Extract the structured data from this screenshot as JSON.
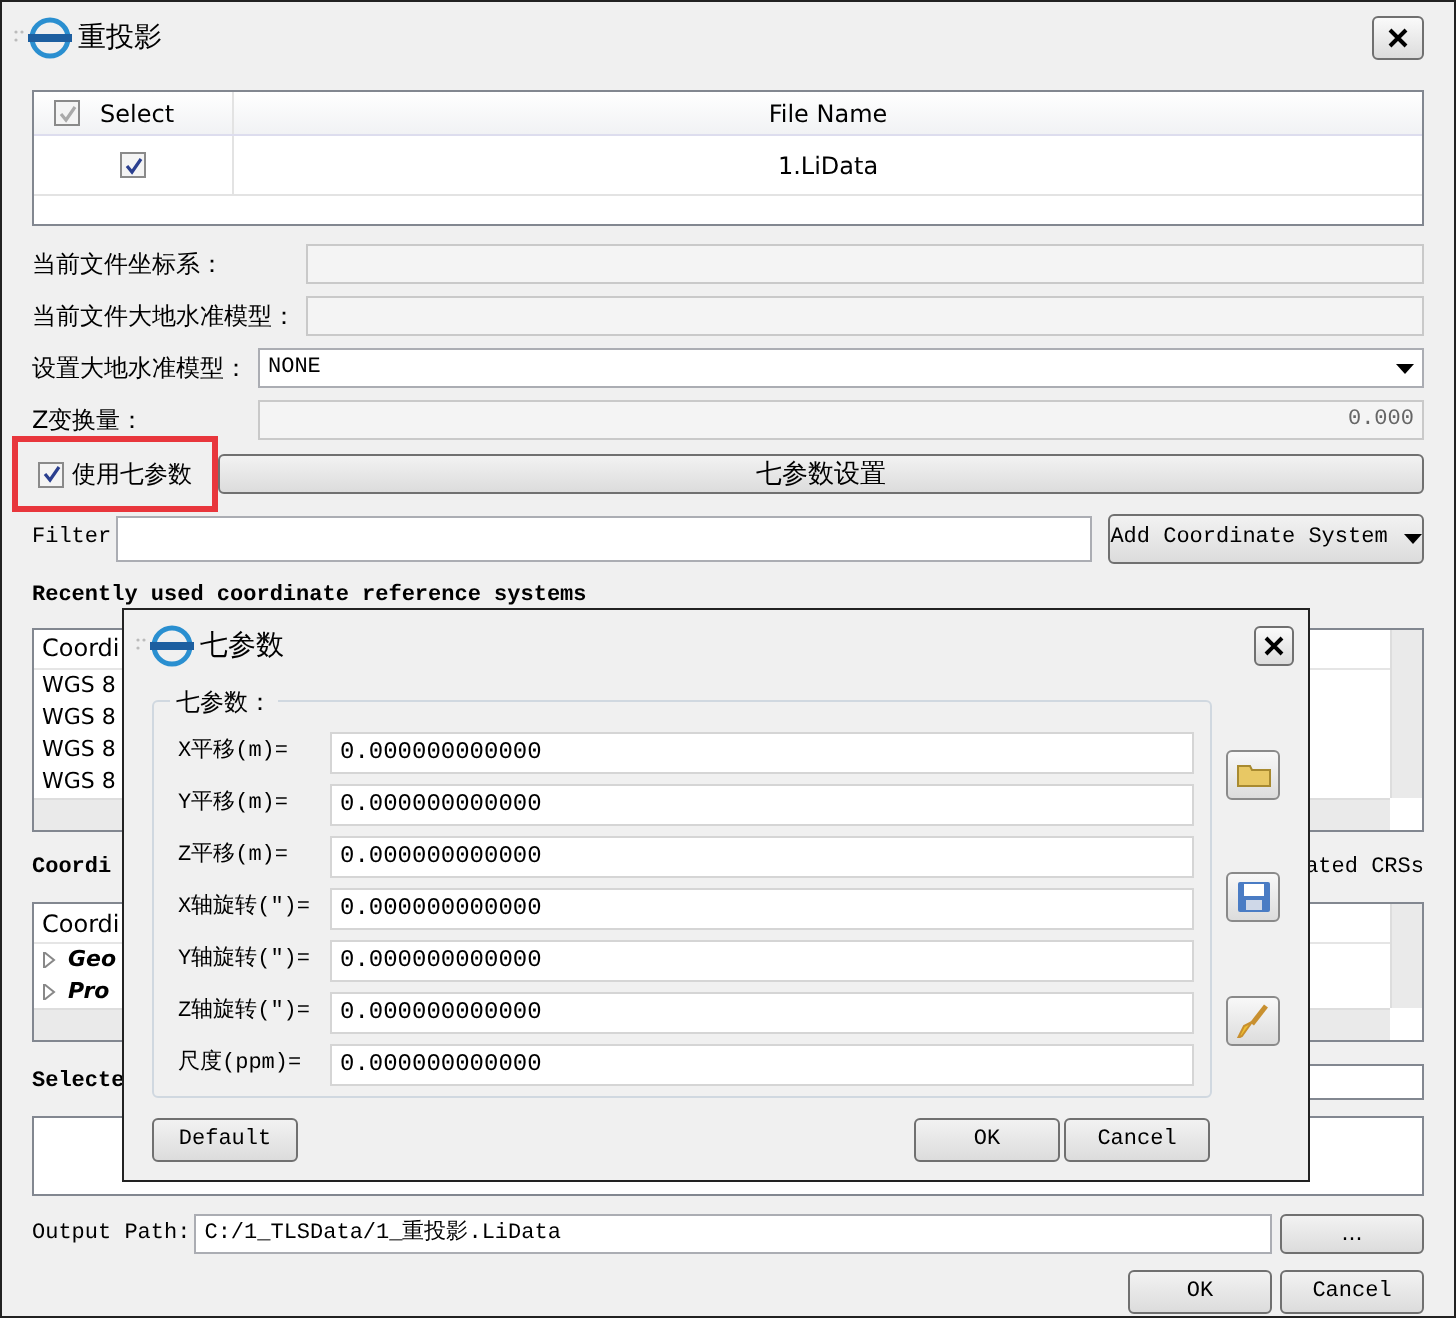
{
  "window": {
    "title": "重投影"
  },
  "file_table": {
    "columns": [
      "Select",
      "File Name"
    ],
    "header_checked": true,
    "rows": [
      {
        "checked": true,
        "file_name": "1.LiData"
      }
    ]
  },
  "fields": [
    {
      "label": "当前文件坐标系：",
      "kind": "text",
      "disabled": true
    },
    {
      "label": "当前文件大地水准模型：",
      "kind": "text",
      "disabled": true
    },
    {
      "label": "设置大地水准模型：",
      "kind": "select",
      "value": "NONE",
      "disabled": false
    },
    {
      "label": "Z变换量：",
      "kind": "number",
      "value": "0.000",
      "disabled": true
    }
  ],
  "seven_param": {
    "label": "使用七参数",
    "checked": true,
    "highlighted": true,
    "button": "七参数设置"
  },
  "filter": {
    "label": "Filter",
    "add_button": "Add Coordinate System"
  },
  "recent": {
    "heading": "Recently used coordinate reference systems",
    "column": "Coordi",
    "rows": [
      "WGS 8",
      "WGS 8",
      "WGS 8",
      "WGS 8"
    ]
  },
  "crs": {
    "heading": "Coordi",
    "heading_end": "ated CRSs",
    "column": "Coordi",
    "tree": [
      {
        "label": "Geo",
        "expanded": false
      },
      {
        "label": "Pro",
        "expanded": false
      }
    ]
  },
  "selected_heading": "Selecte",
  "output": {
    "label": "Output Path:",
    "value": "C:/1_TLSData/1_重投影.LiData",
    "browse": "..."
  },
  "buttons": [
    "OK",
    "Cancel"
  ],
  "dialog": {
    "title": "七参数",
    "group": "七参数：",
    "params": [
      {
        "label": "X平移(m)=",
        "value": "0.000000000000"
      },
      {
        "label": "Y平移(m)=",
        "value": "0.000000000000"
      },
      {
        "label": "Z平移(m)=",
        "value": "0.000000000000"
      },
      {
        "label": "X轴旋转(″)=",
        "value": "0.000000000000"
      },
      {
        "label": "Y轴旋转(″)=",
        "value": "0.000000000000"
      },
      {
        "label": "Z轴旋转(″)=",
        "value": "0.000000000000"
      },
      {
        "label": "尺度(ppm)=",
        "value": "0.000000000000"
      }
    ],
    "default_button": "Default",
    "buttons": [
      "OK",
      "Cancel"
    ]
  }
}
